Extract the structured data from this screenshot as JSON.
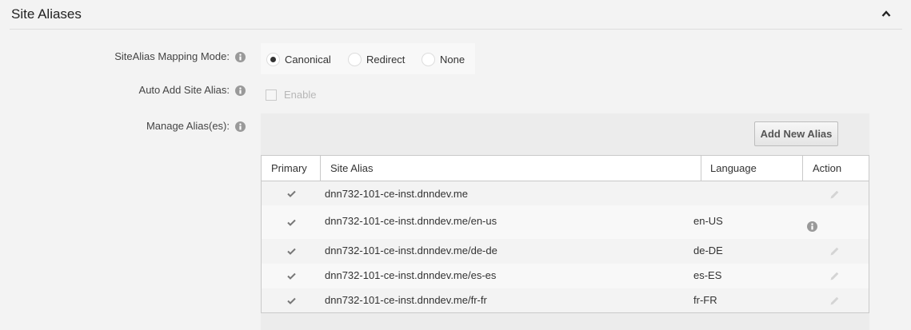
{
  "section": {
    "title": "Site Aliases"
  },
  "fields": {
    "mapping_mode_label": "SiteAlias Mapping Mode:",
    "auto_add_label": "Auto Add Site Alias:",
    "manage_label": "Manage Alias(es):"
  },
  "mapping_mode": {
    "options": [
      "Canonical",
      "Redirect",
      "None"
    ],
    "selected": "Canonical"
  },
  "auto_add": {
    "checkbox_label": "Enable",
    "checked": false,
    "disabled": true
  },
  "aliases": {
    "add_button_label": "Add New Alias",
    "columns": [
      "Primary",
      "Site Alias",
      "Language",
      "Action"
    ],
    "rows": [
      {
        "primary": true,
        "alias": "dnn732-101-ce-inst.dnndev.me",
        "language": "",
        "action": "edit-icon"
      },
      {
        "primary": true,
        "alias": "dnn732-101-ce-inst.dnndev.me/en-us",
        "language": "en-US",
        "action": "info-icon"
      },
      {
        "primary": true,
        "alias": "dnn732-101-ce-inst.dnndev.me/de-de",
        "language": "de-DE",
        "action": "edit-icon"
      },
      {
        "primary": true,
        "alias": "dnn732-101-ce-inst.dnndev.me/es-es",
        "language": "es-ES",
        "action": "edit-icon"
      },
      {
        "primary": true,
        "alias": "dnn732-101-ce-inst.dnndev.me/fr-fr",
        "language": "fr-FR",
        "action": "edit-icon"
      }
    ]
  },
  "colors": {
    "page_background": "#f3f3f3",
    "panel_background": "#ececec",
    "border": "#c9c9c9",
    "text": "#333333",
    "icon_gray": "#999999"
  }
}
